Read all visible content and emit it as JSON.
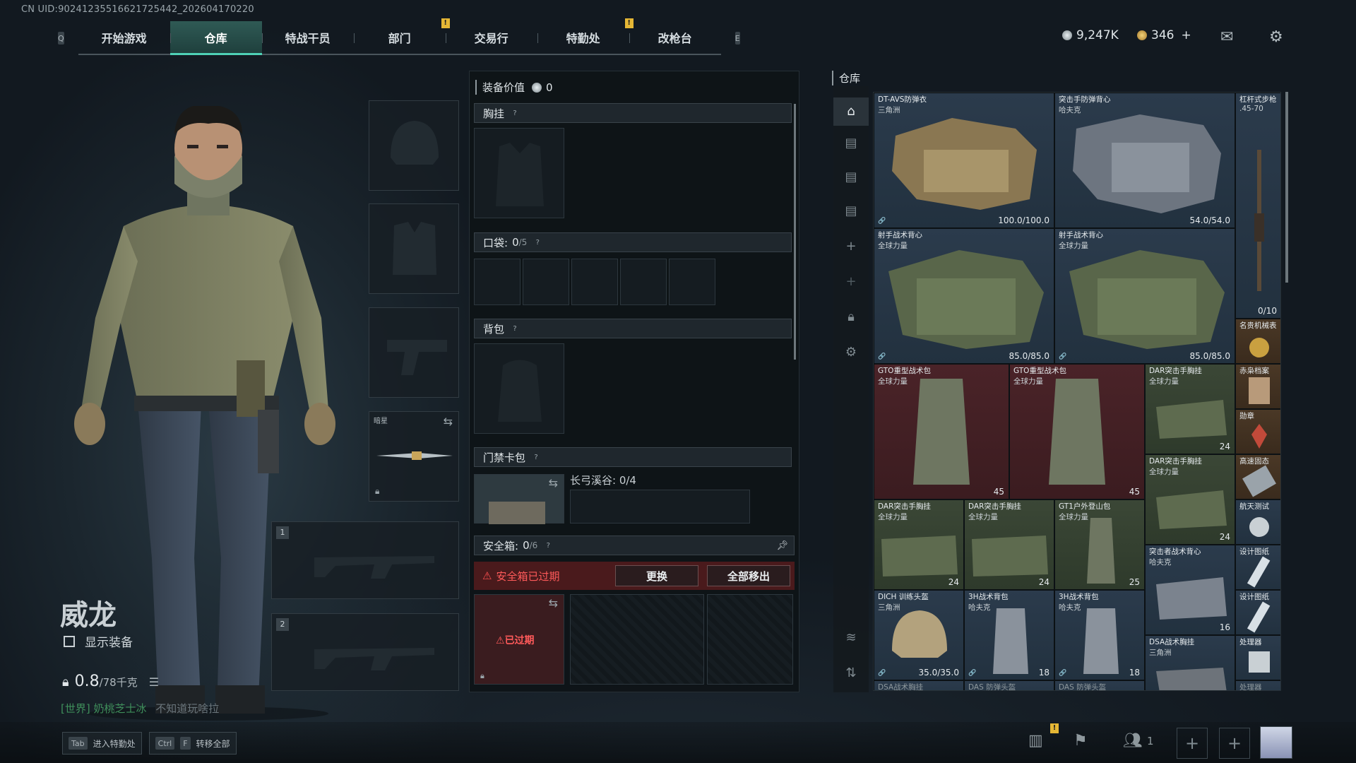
{
  "uid": "CN UID:9024123551662172544​2_202604170220",
  "nav": {
    "left_key": "Q",
    "right_key": "E",
    "tabs": [
      {
        "label": "开始游戏"
      },
      {
        "label": "仓库",
        "active": true
      },
      {
        "label": "特战干员"
      },
      {
        "label": "部门",
        "notif": "!"
      },
      {
        "label": "交易行"
      },
      {
        "label": "特勤处",
        "notif": "!"
      },
      {
        "label": "改枪台"
      }
    ]
  },
  "currency": {
    "coins": "9,247K",
    "tokens": "346",
    "add": "+"
  },
  "character": {
    "name": "威龙",
    "show_equipment": "显示装备",
    "weight": "0.8",
    "weight_max": "/78千克",
    "chat_channel": "[世界] 奶桃芝士冰",
    "chat_text": "不知道玩啥拉"
  },
  "bottom_keys": [
    {
      "keys": [
        "Tab"
      ],
      "label": "进入特勤处"
    },
    {
      "keys": [
        "Ctrl",
        "F"
      ],
      "label": "转移全部"
    }
  ],
  "equip_slots": {
    "melee_label": "暗星",
    "slot1": "1",
    "slot2": "2"
  },
  "loadout": {
    "value_label": "装备价值",
    "value": "0",
    "chest": "胸挂",
    "pocket": "口袋:",
    "pocket_count": "0",
    "pocket_max": "/5",
    "backpack": "背包",
    "keycard": "门禁卡包",
    "keycard_sub": "长弓溪谷: 0/4",
    "safebox": "安全箱:",
    "safebox_count": "0",
    "safebox_max": "/6",
    "expired_warning": "安全箱已过期",
    "replace_button": "更换",
    "move_all_button": "全部移出",
    "expired_tag": "已过期"
  },
  "warehouse": {
    "title": "仓库",
    "items": [
      {
        "name": "DT-AVS防弹衣",
        "sub": "三角洲",
        "dur": "100.0/100.0"
      },
      {
        "name": "突击手防弹背心",
        "sub": "哈夫克",
        "dur": "54.0/54.0"
      },
      {
        "name": "杠杆式步枪",
        "sub": ".45-70",
        "dur": "0/10"
      },
      {
        "name": "射手战术背心",
        "sub": "全球力量",
        "dur": "85.0/85.0"
      },
      {
        "name": "射手战术背心",
        "sub": "全球力量",
        "dur": "85.0/85.0"
      },
      {
        "name": "名贵机械表",
        "sub": "",
        "dur": ""
      },
      {
        "name": "GTO重型战术包",
        "sub": "全球力量",
        "dur": "45"
      },
      {
        "name": "GTO重型战术包",
        "sub": "全球力量",
        "dur": "45"
      },
      {
        "name": "DAR突击手胸挂",
        "sub": "全球力量",
        "dur": "24"
      },
      {
        "name": "赤枭档案",
        "sub": "",
        "dur": ""
      },
      {
        "name": "勋章",
        "sub": "",
        "dur": ""
      },
      {
        "name": "DAR突击手胸挂",
        "sub": "全球力量",
        "dur": "24"
      },
      {
        "name": "高速固态",
        "sub": "",
        "dur": ""
      },
      {
        "name": "DAR突击手胸挂",
        "sub": "全球力量",
        "dur": "24"
      },
      {
        "name": "DAR突击手胸挂",
        "sub": "全球力量",
        "dur": "24"
      },
      {
        "name": "GT1户外登山包",
        "sub": "全球力量",
        "dur": "25"
      },
      {
        "name": "航天测试",
        "sub": "",
        "dur": ""
      },
      {
        "name": "突击者战术背心",
        "sub": "哈夫克",
        "dur": "16"
      },
      {
        "name": "设计图纸",
        "sub": "",
        "dur": ""
      },
      {
        "name": "DICH 训练头盔",
        "sub": "三角洲",
        "dur": "35.0/35.0"
      },
      {
        "name": "3H战术背包",
        "sub": "哈夫克",
        "dur": "18"
      },
      {
        "name": "3H战术背包",
        "sub": "哈夫克",
        "dur": "18"
      },
      {
        "name": "设计图纸",
        "sub": "",
        "dur": ""
      },
      {
        "name": "DSA战术胸挂",
        "sub": "三角洲",
        "dur": ""
      },
      {
        "name": "处理器",
        "sub": "",
        "dur": ""
      },
      {
        "name": "DSA战术胸挂",
        "sub": "",
        "dur": ""
      },
      {
        "name": "DAS 防弹头盔",
        "sub": "",
        "dur": ""
      },
      {
        "name": "DAS 防弹头盔",
        "sub": "",
        "dur": ""
      },
      {
        "name": "处理器",
        "sub": "",
        "dur": ""
      }
    ]
  },
  "bottom_bar": {
    "friends": "1",
    "notif": "!"
  },
  "colors": {
    "accent": "#4fd1b6",
    "warn": "#e5b735",
    "danger": "#ff4f4f"
  }
}
